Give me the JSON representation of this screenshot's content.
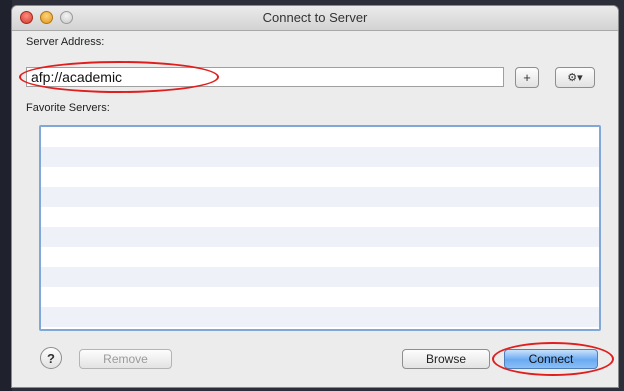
{
  "window": {
    "title": "Connect to Server"
  },
  "address": {
    "label": "Server Address:",
    "value": "afp://academic"
  },
  "buttons": {
    "add": "+",
    "action": "⚙▾",
    "help": "?",
    "remove": "Remove",
    "browse": "Browse",
    "connect": "Connect"
  },
  "favorites": {
    "label": "Favorite Servers:",
    "items": []
  },
  "colors": {
    "annotation": "#e11e1e",
    "list_focus": "#7fa8d8",
    "default_button": "#6aaaf2"
  },
  "icons": [
    "close-icon",
    "minimize-icon",
    "zoom-icon",
    "add-icon",
    "action-gear-icon",
    "help-icon"
  ]
}
